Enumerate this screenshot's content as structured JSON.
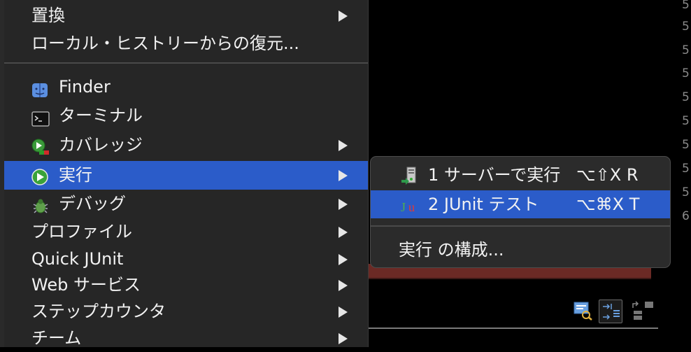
{
  "menu": {
    "items": [
      {
        "label": "置換",
        "icon": null,
        "submenu": true
      },
      {
        "label": "ローカル・ヒストリーからの復元...",
        "icon": null,
        "submenu": false
      },
      {
        "label": "Finder",
        "icon": "finder-icon",
        "submenu": false
      },
      {
        "label": "ターミナル",
        "icon": "terminal-icon",
        "submenu": false
      },
      {
        "label": "カバレッジ",
        "icon": "coverage-icon",
        "submenu": true
      },
      {
        "label": "実行",
        "icon": "run-icon",
        "submenu": true,
        "selected": true
      },
      {
        "label": "デバッグ",
        "icon": "debug-bug-icon",
        "submenu": true
      },
      {
        "label": "プロファイル",
        "icon": null,
        "submenu": true
      },
      {
        "label": "Quick JUnit",
        "icon": null,
        "submenu": true
      },
      {
        "label": "Web サービス",
        "icon": null,
        "submenu": true
      },
      {
        "label": "ステップカウンタ",
        "icon": null,
        "submenu": true
      },
      {
        "label": "チーム",
        "icon": null,
        "submenu": true
      }
    ]
  },
  "submenu": {
    "items": [
      {
        "label": "1 サーバーで実行",
        "shortcut": "⌥⇧X R",
        "icon": "server-run-icon"
      },
      {
        "label": "2 JUnit テスト",
        "shortcut": "⌥⌘X T",
        "icon": "junit-icon",
        "selected": true
      },
      {
        "label": "実行 の構成...",
        "shortcut": "",
        "icon": null
      }
    ]
  },
  "gutter": {
    "numbers": [
      "5",
      "5",
      "5",
      "5",
      "5",
      "5",
      "5",
      "5",
      "5",
      "6"
    ]
  },
  "colors": {
    "selection": "#2b5cc9",
    "menu_bg": "#262626",
    "accent_red": "#6b2a25"
  }
}
